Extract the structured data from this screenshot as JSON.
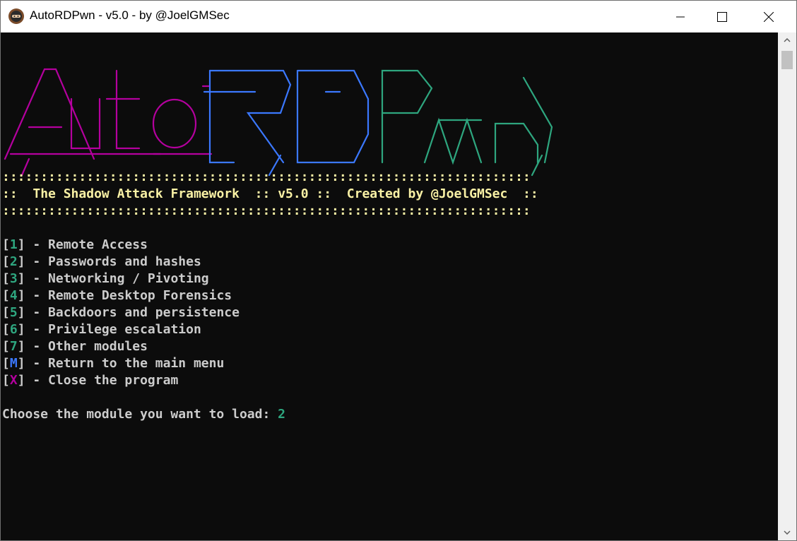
{
  "window": {
    "title": "AutoRDPwn - v5.0 - by @JoelGMSec"
  },
  "colors": {
    "console_bg": "#0c0c0c",
    "text_default": "#cccccc",
    "header_yellow": "#f9f1a5",
    "key_teal": "#2ea67f",
    "key_blue": "#3b78ff",
    "key_magenta": "#b4009e",
    "banner_magenta": "#b4009e",
    "banner_blue": "#3b78ff",
    "banner_teal": "#2ea67f"
  },
  "banner": {
    "text": "AutoRDPwn",
    "ascii_art": "AutoRDPwn logo"
  },
  "header": {
    "divider": ":::::::::::::::::::::::::::::::::::::::::::::::::::::::::::::::::::::",
    "left_colons": "::",
    "framework": "The Shadow Attack Framework",
    "sep": "::",
    "version": "v5.0",
    "sep2": "::",
    "created_by": "Created by @JoelGMSec",
    "right_colons": "::"
  },
  "menu": {
    "items": [
      {
        "key": "1",
        "label": "Remote Access"
      },
      {
        "key": "2",
        "label": "Passwords and hashes"
      },
      {
        "key": "3",
        "label": "Networking / Pivoting"
      },
      {
        "key": "4",
        "label": "Remote Desktop Forensics"
      },
      {
        "key": "5",
        "label": "Backdoors and persistence"
      },
      {
        "key": "6",
        "label": "Privilege escalation"
      },
      {
        "key": "7",
        "label": "Other modules"
      },
      {
        "key": "M",
        "label": "Return to the main menu"
      },
      {
        "key": "X",
        "label": "Close the program"
      }
    ]
  },
  "prompt": {
    "text": "Choose the module you want to load:",
    "value": "2"
  },
  "icons": {
    "app": "ninja-avatar-icon",
    "minimize": "minimize-icon",
    "maximize": "maximize-icon",
    "close": "close-icon",
    "scroll_up": "arrow-up-icon",
    "scroll_down": "arrow-down-icon"
  }
}
